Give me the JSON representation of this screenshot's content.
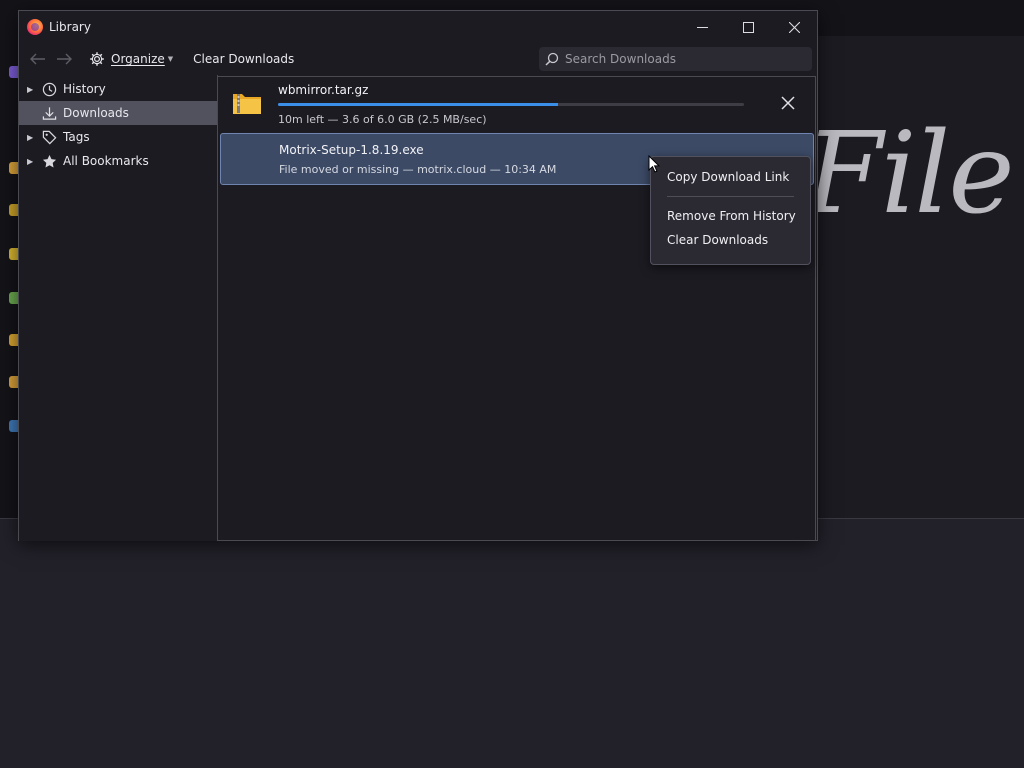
{
  "window": {
    "title": "Library",
    "minimize_glyph": "—",
    "maximize_glyph": "☐",
    "close_glyph": "✕"
  },
  "background": {
    "big_text": "File"
  },
  "toolbar": {
    "organize_label": "Organize",
    "clear_downloads_label": "Clear Downloads",
    "search_placeholder": "Search Downloads"
  },
  "sidebar": {
    "items": [
      {
        "label": "History",
        "icon": "clock-icon",
        "expandable": true,
        "selected": false
      },
      {
        "label": "Downloads",
        "icon": "download-icon",
        "expandable": false,
        "selected": true
      },
      {
        "label": "Tags",
        "icon": "tag-icon",
        "expandable": true,
        "selected": false
      },
      {
        "label": "All Bookmarks",
        "icon": "star-icon",
        "expandable": true,
        "selected": false
      }
    ]
  },
  "downloads": [
    {
      "filename": "wbmirror.tar.gz",
      "status": "10m left — 3.6 of 6.0 GB (2.5 MB/sec)",
      "progress_fraction": 0.6,
      "icon": "archive-folder-icon",
      "action": "cancel-icon"
    },
    {
      "filename": "Motrix-Setup-1.8.19.exe",
      "status": "File moved or missing — motrix.cloud — 10:34 AM",
      "icon": "exe-file-icon",
      "selected": true
    }
  ],
  "context_menu": {
    "items": [
      "Copy Download Link",
      "Remove From History",
      "Clear Downloads"
    ]
  },
  "colors": {
    "accent": "#3b8fe8",
    "selected_row": "#3c4a66",
    "window_bg": "#1c1b22"
  }
}
